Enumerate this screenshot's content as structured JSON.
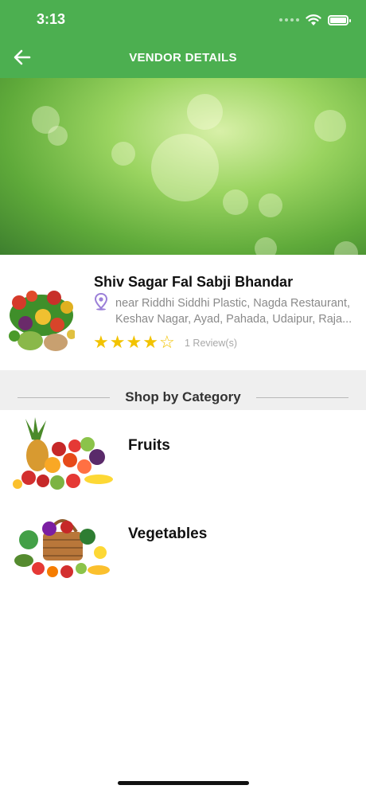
{
  "status_bar": {
    "time": "3:13"
  },
  "header": {
    "title": "VENDOR DETAILS"
  },
  "vendor": {
    "name": "Shiv Sagar Fal Sabji Bhandar",
    "address_line1": "near Riddhi Siddhi Plastic, Nagda Restaurant,",
    "address_line2": "Keshav Nagar, Ayad, Pahada, Udaipur, Raja...",
    "rating": 4,
    "rating_max": 5,
    "reviews": "1 Review(s)"
  },
  "category_section": {
    "title": "Shop by Category"
  },
  "categories": [
    {
      "name": "Fruits"
    },
    {
      "name": "Vegetables"
    }
  ],
  "colors": {
    "primary": "#4caf50",
    "star": "#f2c300",
    "pin": "#9b7fd8"
  },
  "icons": [
    "back-arrow-icon",
    "wifi-icon",
    "battery-icon",
    "location-pin-icon",
    "star-icon"
  ]
}
